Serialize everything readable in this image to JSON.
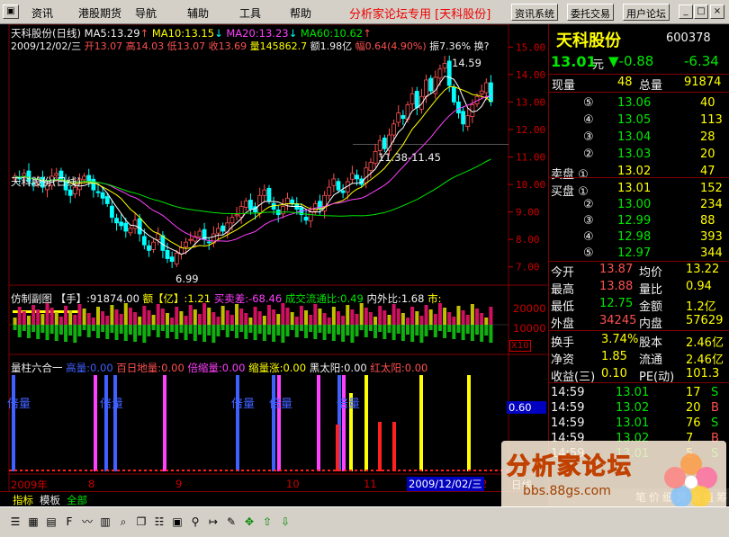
{
  "menu": {
    "items": [
      "资讯",
      "港股期货",
      "导航",
      "辅助",
      "工具",
      "帮助"
    ],
    "banner": "分析家论坛专用 [天科股份]",
    "buttons": [
      "资讯系统",
      "委托交易",
      "用户论坛"
    ]
  },
  "window": {
    "minimize": "_",
    "restore": "□",
    "close": "×"
  },
  "main_header": {
    "line1": {
      "name": "天科股份(日线)",
      "ma5": "MA5:13.29",
      "ma10": "MA10:13.15",
      "ma20": "MA20:13.23",
      "ma60": "MA60:10.62"
    },
    "line2": {
      "date": "2009/12/02/三",
      "open": "开13.07",
      "high": "高14.03",
      "low": "低13.07",
      "close": "收13.69",
      "vol": "量145862.7",
      "amt": "额1.98亿",
      "chg": "幅0.64(4.90%)",
      "amp": "振7.36%",
      "tail": "换?"
    },
    "watermark_name": "天科股份(日线)"
  },
  "price_axis": [
    "15.00",
    "14.00",
    "13.00",
    "12.00",
    "11.00",
    "10.00",
    "9.00",
    "8.00",
    "7.00"
  ],
  "annotations": {
    "high": "14.59",
    "low": "6.99",
    "range": "11.38-11.45"
  },
  "sub1": {
    "title": "仿制副图",
    "hand": "【手】:91874.00",
    "amt": "额【亿】:1.21",
    "diff": "买卖差:-68.46",
    "ratio": "成交流通比:0.49",
    "inout": "内外比:1.68",
    "tail": "市:",
    "axis_top": "20000",
    "axis_mid": "10000",
    "axis_unit": "X10"
  },
  "sub2": {
    "title": "量柱六合一",
    "items": [
      "高量:0.00",
      "百日地量:0.00",
      "倍缩量:0.00",
      "缩量涨:0.00",
      "黑太阳:0.00",
      "红太阳:0.00"
    ],
    "labels": [
      "倍量",
      "倍量",
      "倍量",
      "倍量",
      "倍量"
    ],
    "value_box": "0.60"
  },
  "time_axis": {
    "labels": [
      "2009年",
      "8",
      "9",
      "10",
      "11",
      "2"
    ],
    "selected": "2009/12/02/三",
    "right_label": "日线"
  },
  "bottom_tabs": [
    "指标",
    "模板",
    "全部"
  ],
  "panel": {
    "name": "天科股份",
    "code": "600378",
    "price": "13.01",
    "unit": "元",
    "chg": "▼-0.88",
    "chg_pct": "-6.34",
    "now_label": "现量",
    "now_val": "48",
    "total_label": "总量",
    "total_val": "91874",
    "sell": [
      {
        "lv": "⑤",
        "p": "13.06",
        "v": "40"
      },
      {
        "lv": "④",
        "p": "13.05",
        "v": "113"
      },
      {
        "lv": "③",
        "p": "13.04",
        "v": "28"
      },
      {
        "lv": "②",
        "p": "13.03",
        "v": "20"
      },
      {
        "lv": "卖盘 ①",
        "p": "13.02",
        "v": "47"
      }
    ],
    "buy": [
      {
        "lv": "买盘 ①",
        "p": "13.01",
        "v": "152"
      },
      {
        "lv": "②",
        "p": "13.00",
        "v": "234"
      },
      {
        "lv": "③",
        "p": "12.99",
        "v": "88"
      },
      {
        "lv": "④",
        "p": "12.98",
        "v": "393"
      },
      {
        "lv": "⑤",
        "p": "12.97",
        "v": "344"
      }
    ],
    "stats": [
      {
        "l1": "今开",
        "v1": "13.87",
        "l2": "均价",
        "v2": "13.22"
      },
      {
        "l1": "最高",
        "v1": "13.88",
        "l2": "量比",
        "v2": "0.94"
      },
      {
        "l1": "最低",
        "v1": "12.75",
        "l2": "金额",
        "v2": "1.2亿"
      },
      {
        "l1": "外盘",
        "v1": "34245",
        "l2": "内盘",
        "v2": "57629"
      }
    ],
    "stats2": [
      {
        "l1": "换手",
        "v1": "3.74%",
        "l2": "股本",
        "v2": "2.46亿"
      },
      {
        "l1": "净资",
        "v1": "1.85",
        "l2": "流通",
        "v2": "2.46亿"
      },
      {
        "l1": "收益(三)",
        "v1": "0.10",
        "l2": "PE(动)",
        "v2": "101.3"
      }
    ],
    "ticks": [
      {
        "t": "14:59",
        "p": "13.01",
        "v": "17",
        "s": "S"
      },
      {
        "t": "14:59",
        "p": "13.02",
        "v": "20",
        "s": "B"
      },
      {
        "t": "14:59",
        "p": "13.01",
        "v": "76",
        "s": "S"
      },
      {
        "t": "14:59",
        "p": "13.02",
        "v": "7",
        "s": "B"
      },
      {
        "t": "14:59",
        "p": "13.01",
        "v": "5",
        "s": "S"
      }
    ]
  },
  "watermark": {
    "title": "分析家论坛",
    "url": "bbs.88gs.com"
  },
  "panel_tabs": [
    "笔",
    "价",
    "细",
    "势",
    "指",
    "值",
    "筹"
  ],
  "toolbar": [
    "list-icon",
    "chart-icon",
    "news-icon",
    "f10-icon",
    "trend-icon",
    "kline-icon",
    "magnify-icon",
    "cascade-icon",
    "layers-icon",
    "calendar-icon",
    "link-icon",
    "export-icon",
    "pencil-icon",
    "move-icon",
    "up-icon",
    "down-icon"
  ],
  "chart_data": {
    "type": "candlestick",
    "ylim": [
      6.5,
      15.5
    ],
    "up_color": "#ff5050",
    "down_color": "#00ffff",
    "closes": [
      10.3,
      10.2,
      10.4,
      10.1,
      10.0,
      10.2,
      9.9,
      10.0,
      10.3,
      10.4,
      10.2,
      9.8,
      9.6,
      9.9,
      10.2,
      10.3,
      10.1,
      9.8,
      9.7,
      9.5,
      9.3,
      8.8,
      8.6,
      8.5,
      8.3,
      8.4,
      8.7,
      8.2,
      7.8,
      7.6,
      7.9,
      8.2,
      7.6,
      7.3,
      7.2,
      7.5,
      7.7,
      7.9,
      8.0,
      8.1,
      8.3,
      8.0,
      7.9,
      8.2,
      8.4,
      8.3,
      8.6,
      8.8,
      8.9,
      9.2,
      9.4,
      9.1,
      9.0,
      9.6,
      9.8,
      9.4,
      9.1,
      8.9,
      9.2,
      9.5,
      9.3,
      9.1,
      8.9,
      8.7,
      9.0,
      9.3,
      9.1,
      9.6,
      9.9,
      10.2,
      9.8,
      9.7,
      10.1,
      10.4,
      10.2,
      10.0,
      10.6,
      10.8,
      11.2,
      11.6,
      11.3,
      11.8,
      12.2,
      12.6,
      12.4,
      12.9,
      13.3,
      12.8,
      13.2,
      13.8,
      13.4,
      13.9,
      14.2,
      14.4,
      13.6,
      13.0,
      12.6,
      12.2,
      12.5,
      12.9,
      13.2,
      13.4,
      13.7,
      13.01
    ]
  }
}
